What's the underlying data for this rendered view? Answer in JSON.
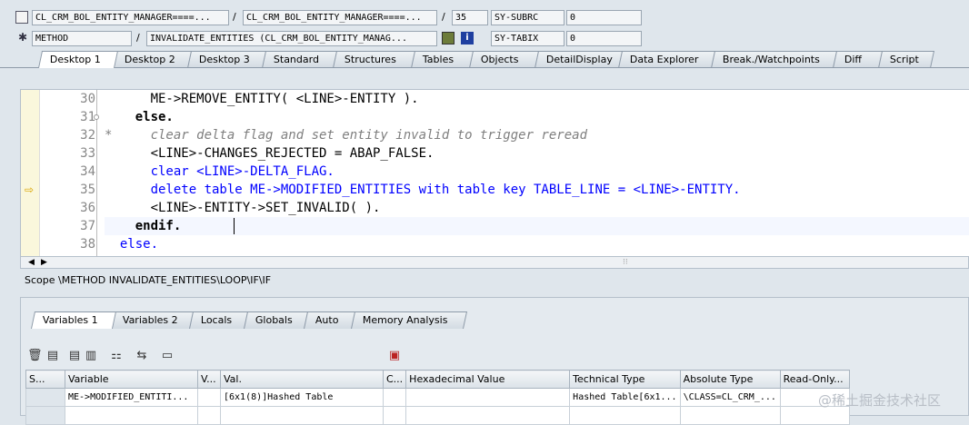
{
  "header": {
    "row1": {
      "class_field": "CL_CRM_BOL_ENTITY_MANAGER====...",
      "sep1": "/",
      "include_field": "CL_CRM_BOL_ENTITY_MANAGER====...",
      "sep2": "/",
      "line_field": "35",
      "sysvar1_name": "SY-SUBRC",
      "sysvar1_value": "0"
    },
    "row2": {
      "type_field": "METHOD",
      "sep1": "/",
      "method_field": "INVALIDATE_ENTITIES (CL_CRM_BOL_ENTITY_MANAG...",
      "sysvar2_name": "SY-TABIX",
      "sysvar2_value": "0"
    }
  },
  "tabs": [
    "Desktop 1",
    "Desktop 2",
    "Desktop 3",
    "Standard",
    "Structures",
    "Tables",
    "Objects",
    "DetailDisplay",
    "Data Explorer",
    "Break./Watchpoints",
    "Diff",
    "Script"
  ],
  "code_lines": [
    {
      "num": "30",
      "text": "      ME->REMOVE_ENTITY( <LINE>-ENTITY )."
    },
    {
      "num": "31",
      "text": "    else."
    },
    {
      "num": "32",
      "text": "*     clear delta flag and set entity invalid to trigger reread"
    },
    {
      "num": "33",
      "text": "      <LINE>-CHANGES_REJECTED = ABAP_FALSE."
    },
    {
      "num": "34",
      "text": "      clear <LINE>-DELTA_FLAG."
    },
    {
      "num": "35",
      "text": "      delete table ME->MODIFIED_ENTITIES with table key TABLE_LINE = <LINE>-ENTITY."
    },
    {
      "num": "36",
      "text": "      <LINE>-ENTITY->SET_INVALID( )."
    },
    {
      "num": "37",
      "text": "    endif."
    },
    {
      "num": "38",
      "text": "  else."
    }
  ],
  "scope": "Scope \\METHOD INVALIDATE_ENTITIES\\LOOP\\IF\\IF",
  "var_tabs": [
    "Variables 1",
    "Variables 2",
    "Locals",
    "Globals",
    "Auto",
    "Memory Analysis"
  ],
  "table": {
    "columns": [
      "S...",
      "Variable",
      "V...",
      "Val.",
      "C...",
      "Hexadecimal Value",
      "Technical Type",
      "Absolute Type",
      "Read-Only..."
    ],
    "rows": [
      [
        "",
        "ME->MODIFIED_ENTITI...",
        "",
        "[6x1(8)]Hashed Table",
        "",
        "",
        "Hashed Table[6x1...",
        "\\CLASS=CL_CRM_...",
        ""
      ]
    ]
  },
  "watermark": "@稀土掘金技术社区",
  "colors": {
    "keyword": "#0000ff",
    "comment": "#7f7f7f",
    "background": "#dfe6ec"
  }
}
